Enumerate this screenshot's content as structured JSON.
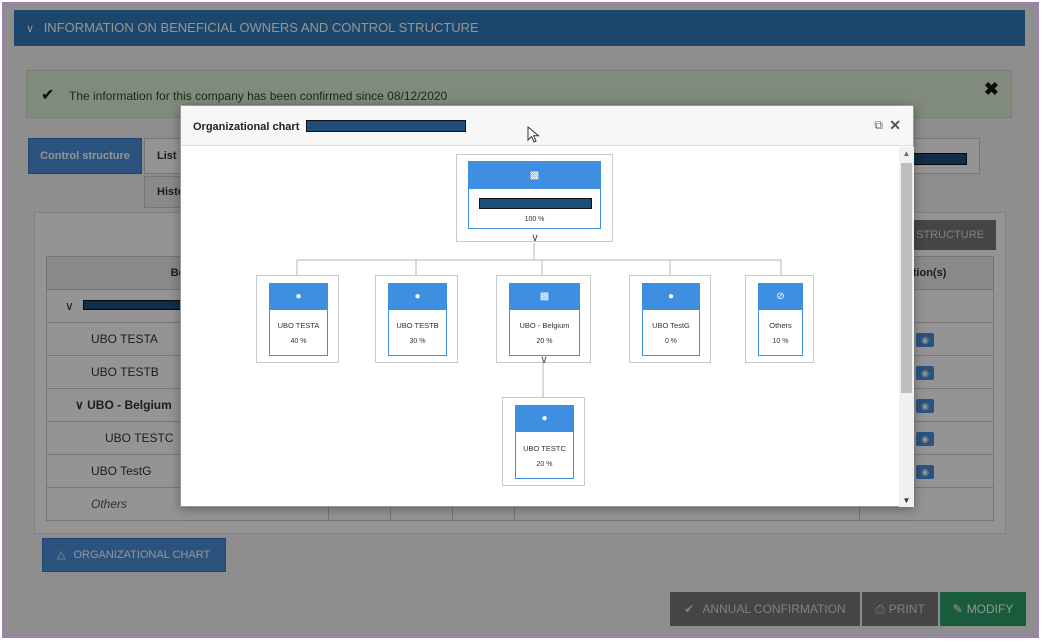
{
  "section": {
    "title": "INFORMATION ON BENEFICIAL OWNERS AND CONTROL STRUCTURE"
  },
  "alert": {
    "message": "The information for this company has been confirmed since 08/12/2020"
  },
  "tabs": {
    "control_structure": "Control structure",
    "list": "List",
    "history": "Histo"
  },
  "panel": {
    "structure_button": "E STRUCTURE",
    "headers": {
      "beneficiary": "Benefi",
      "actions": "ction(s)"
    },
    "rows": [
      {
        "name": "UBO TESTA",
        "style": "name"
      },
      {
        "name": "UBO TESTB",
        "style": "name"
      },
      {
        "name": "UBO - Belgium",
        "style": "grp"
      },
      {
        "name": "UBO TESTC",
        "style": "sub"
      },
      {
        "name": "UBO TestG",
        "style": "name"
      },
      {
        "name": "Others",
        "style": "others"
      }
    ]
  },
  "buttons": {
    "org_chart": "ORGANIZATIONAL CHART",
    "annual": "ANNUAL CONFIRMATION",
    "print": "PRINT",
    "modify": "MODIFY"
  },
  "modal": {
    "title": "Organizational chart",
    "root": {
      "pct": "100 %",
      "icon": "building-icon"
    },
    "children": [
      {
        "name": "UBO TESTA",
        "pct": "40 %",
        "icon": "user-icon"
      },
      {
        "name": "UBO TESTB",
        "pct": "30 %",
        "icon": "user-icon"
      },
      {
        "name": "UBO - Belgium",
        "pct": "20 %",
        "icon": "building-icon"
      },
      {
        "name": "UBO TestG",
        "pct": "0 %",
        "icon": "user-icon"
      },
      {
        "name": "Others",
        "pct": "10 %",
        "icon": "eye-slash-icon"
      }
    ],
    "grandchild": {
      "name": "UBO TESTC",
      "pct": "20 %",
      "icon": "user-icon"
    }
  },
  "colors": {
    "primary": "#337ab7",
    "node_blue": "#3f8fe0",
    "modify_green": "#2e9e6a",
    "redaction": "#1e4f7a"
  }
}
